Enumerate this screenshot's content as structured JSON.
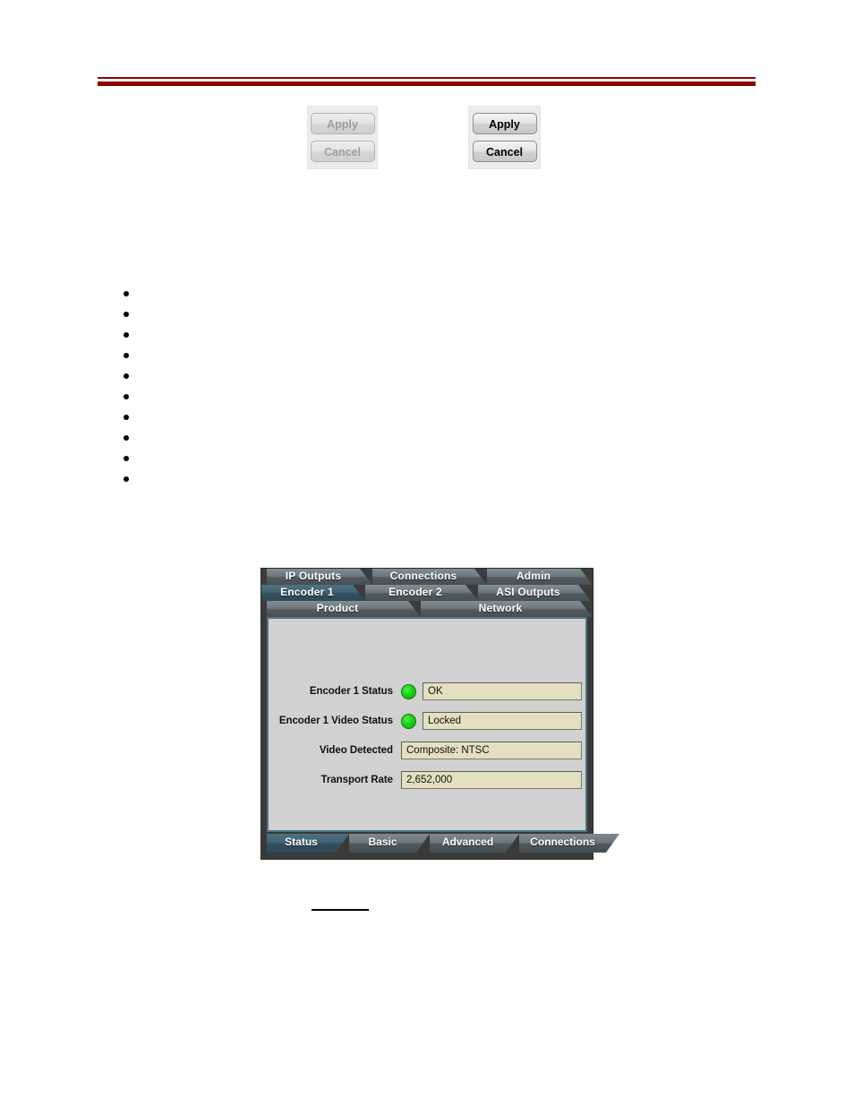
{
  "page": {
    "header_rule_color": "#8b0000",
    "background": "#ffffff"
  },
  "button_groups": [
    {
      "name": "disabled-group",
      "state": "disabled",
      "apply_label": "Apply",
      "cancel_label": "Cancel",
      "text_color": "#9d9d9d"
    },
    {
      "name": "enabled-group",
      "state": "enabled",
      "apply_label": "Apply",
      "cancel_label": "Cancel",
      "text_color": "#000000"
    }
  ],
  "bullet_list": {
    "count": 10,
    "items": [
      "",
      "",
      "",
      "",
      "",
      "",
      "",
      "",
      "",
      ""
    ]
  },
  "encoder_widget": {
    "top_tabs": {
      "row1": [
        {
          "label": "IP Outputs",
          "selected": false
        },
        {
          "label": "Connections",
          "selected": false
        },
        {
          "label": "Admin",
          "selected": false
        }
      ],
      "row2": [
        {
          "label": "Encoder 1",
          "selected": true
        },
        {
          "label": "Encoder 2",
          "selected": false
        },
        {
          "label": "ASI Outputs",
          "selected": false
        }
      ],
      "row3": [
        {
          "label": "Product",
          "selected": false
        },
        {
          "label": "Network",
          "selected": false
        }
      ]
    },
    "fields": [
      {
        "label": "Encoder 1 Status",
        "value": "OK",
        "has_led": true,
        "led_color": "#17d417",
        "led_state": "green"
      },
      {
        "label": "Encoder 1 Video Status",
        "value": "Locked",
        "has_led": true,
        "led_color": "#17d417",
        "led_state": "green"
      },
      {
        "label": "Video Detected",
        "value": "Composite: NTSC",
        "has_led": false
      },
      {
        "label": "Transport Rate",
        "value": "2,652,000",
        "has_led": false
      }
    ],
    "bottom_tabs": [
      {
        "label": "Status",
        "selected": true
      },
      {
        "label": "Basic",
        "selected": false
      },
      {
        "label": "Advanced",
        "selected": false
      },
      {
        "label": "Connections",
        "selected": false
      }
    ],
    "colors": {
      "panel_background": "#d1d1d1",
      "panel_border": "#4c7684",
      "field_background": "#e3e0c0",
      "tab_selected": "#34505e",
      "tab_normal": "#6d797e",
      "frame": "#3a3a3a"
    }
  }
}
